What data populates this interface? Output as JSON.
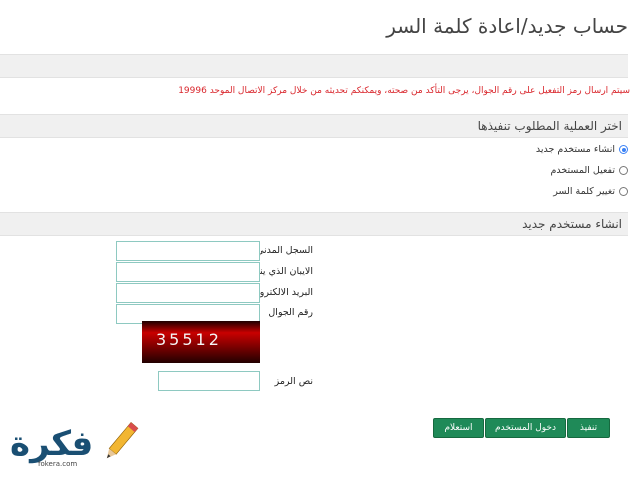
{
  "page": {
    "title": "حساب جديد/اعادة كلمة السر",
    "notice": "سيتم ارسال رمز التفعيل على رقم الجوال، يرجى التأكد من صحته، ويمكنكم تحديثه من خلال مركز الاتصال الموحد 19996"
  },
  "operation": {
    "heading": "اختر العملية المطلوب تنفيذها",
    "options": [
      {
        "label": "انشاء مستخدم جديد",
        "selected": true
      },
      {
        "label": "تفعيل المستخدم",
        "selected": false
      },
      {
        "label": "تغيير كلمة السر",
        "selected": false
      }
    ]
  },
  "form": {
    "heading": "انشاء مستخدم جديد",
    "required_mark": "*",
    "fields": [
      {
        "label": "السجل المدني",
        "required": true,
        "value": ""
      },
      {
        "label": "الايبان الذي ينزل عليه الراتب",
        "required": true,
        "value": ""
      },
      {
        "label": "البريد الالكتروني",
        "required": true,
        "value": ""
      },
      {
        "label": "رقم الجوال",
        "required": false,
        "value": ""
      }
    ],
    "captcha_text": "35512",
    "captcha_label": "نص الرمز",
    "captcha_value": ""
  },
  "buttons": {
    "execute": "تنفيذ",
    "login": "دخول المستخدم",
    "query": "استعلام"
  },
  "watermark": {
    "text": "فكرة",
    "url": "fokera.com"
  },
  "colors": {
    "accent": "#1f8a58",
    "notice": "#d9262c",
    "input_border": "#8ec9c1"
  }
}
